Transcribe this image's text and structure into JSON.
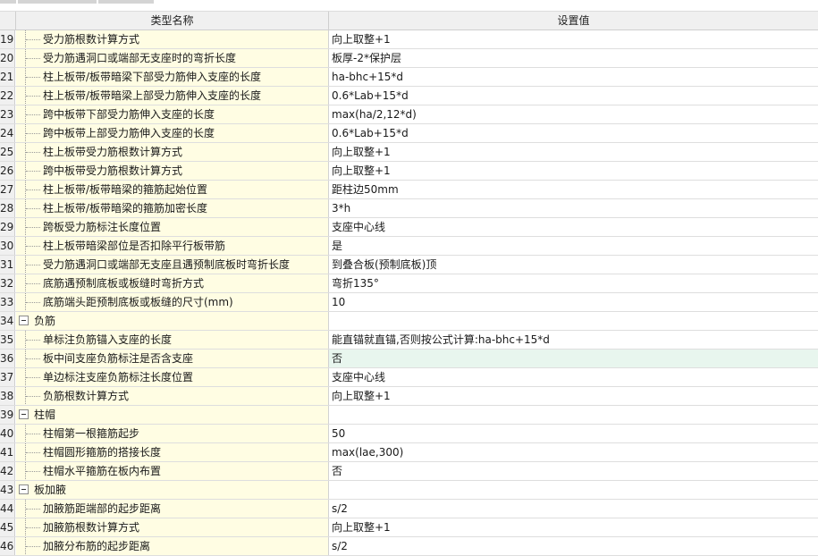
{
  "table": {
    "header": {
      "name": "类型名称",
      "value": "设置值"
    },
    "rows": [
      {
        "num": "19",
        "name": "受力筋根数计算方式",
        "value": "向上取整+1",
        "type": "child"
      },
      {
        "num": "20",
        "name": "受力筋遇洞口或端部无支座时的弯折长度",
        "value": "板厚-2*保护层",
        "type": "child"
      },
      {
        "num": "21",
        "name": "柱上板带/板带暗梁下部受力筋伸入支座的长度",
        "value": "ha-bhc+15*d",
        "type": "child"
      },
      {
        "num": "22",
        "name": "柱上板带/板带暗梁上部受力筋伸入支座的长度",
        "value": "0.6*Lab+15*d",
        "type": "child"
      },
      {
        "num": "23",
        "name": "跨中板带下部受力筋伸入支座的长度",
        "value": "max(ha/2,12*d)",
        "type": "child"
      },
      {
        "num": "24",
        "name": "跨中板带上部受力筋伸入支座的长度",
        "value": "0.6*Lab+15*d",
        "type": "child"
      },
      {
        "num": "25",
        "name": "柱上板带受力筋根数计算方式",
        "value": "向上取整+1",
        "type": "child"
      },
      {
        "num": "26",
        "name": "跨中板带受力筋根数计算方式",
        "value": "向上取整+1",
        "type": "child"
      },
      {
        "num": "27",
        "name": "柱上板带/板带暗梁的箍筋起始位置",
        "value": "距柱边50mm",
        "type": "child"
      },
      {
        "num": "28",
        "name": "柱上板带/板带暗梁的箍筋加密长度",
        "value": "3*h",
        "type": "child"
      },
      {
        "num": "29",
        "name": "跨板受力筋标注长度位置",
        "value": "支座中心线",
        "type": "child"
      },
      {
        "num": "30",
        "name": "柱上板带暗梁部位是否扣除平行板带筋",
        "value": "是",
        "type": "child"
      },
      {
        "num": "31",
        "name": "受力筋遇洞口或端部无支座且遇预制底板时弯折长度",
        "value": "到叠合板(预制底板)顶",
        "type": "child"
      },
      {
        "num": "32",
        "name": "底筋遇预制底板或板缝时弯折方式",
        "value": "弯折135°",
        "type": "child"
      },
      {
        "num": "33",
        "name": "底筋端头距预制底板或板缝的尺寸(mm)",
        "value": "10",
        "type": "child"
      },
      {
        "num": "34",
        "name": "负筋",
        "value": "",
        "type": "group"
      },
      {
        "num": "35",
        "name": "单标注负筋锚入支座的长度",
        "value": "能直锚就直锚,否则按公式计算:ha-bhc+15*d",
        "type": "child"
      },
      {
        "num": "36",
        "name": "板中间支座负筋标注是否含支座",
        "value": "否",
        "type": "child",
        "highlight": true
      },
      {
        "num": "37",
        "name": "单边标注支座负筋标注长度位置",
        "value": "支座中心线",
        "type": "child"
      },
      {
        "num": "38",
        "name": "负筋根数计算方式",
        "value": "向上取整+1",
        "type": "child"
      },
      {
        "num": "39",
        "name": "柱帽",
        "value": "",
        "type": "group"
      },
      {
        "num": "40",
        "name": "柱帽第一根箍筋起步",
        "value": "50",
        "type": "child"
      },
      {
        "num": "41",
        "name": "柱帽圆形箍筋的搭接长度",
        "value": "max(lae,300)",
        "type": "child"
      },
      {
        "num": "42",
        "name": "柱帽水平箍筋在板内布置",
        "value": "否",
        "type": "child"
      },
      {
        "num": "43",
        "name": "板加腋",
        "value": "",
        "type": "group"
      },
      {
        "num": "44",
        "name": "加腋筋距端部的起步距离",
        "value": "s/2",
        "type": "child"
      },
      {
        "num": "45",
        "name": "加腋筋根数计算方式",
        "value": "向上取整+1",
        "type": "child"
      },
      {
        "num": "46",
        "name": "加腋分布筋的起步距离",
        "value": "s/2",
        "type": "child"
      }
    ]
  },
  "colors": {
    "name_cell_bg": "#fffde3",
    "highlight_bg": "#e8f6ee",
    "header_bg": "#f0f0f0"
  },
  "icons": {
    "group_toggle": "minus-box-icon"
  }
}
